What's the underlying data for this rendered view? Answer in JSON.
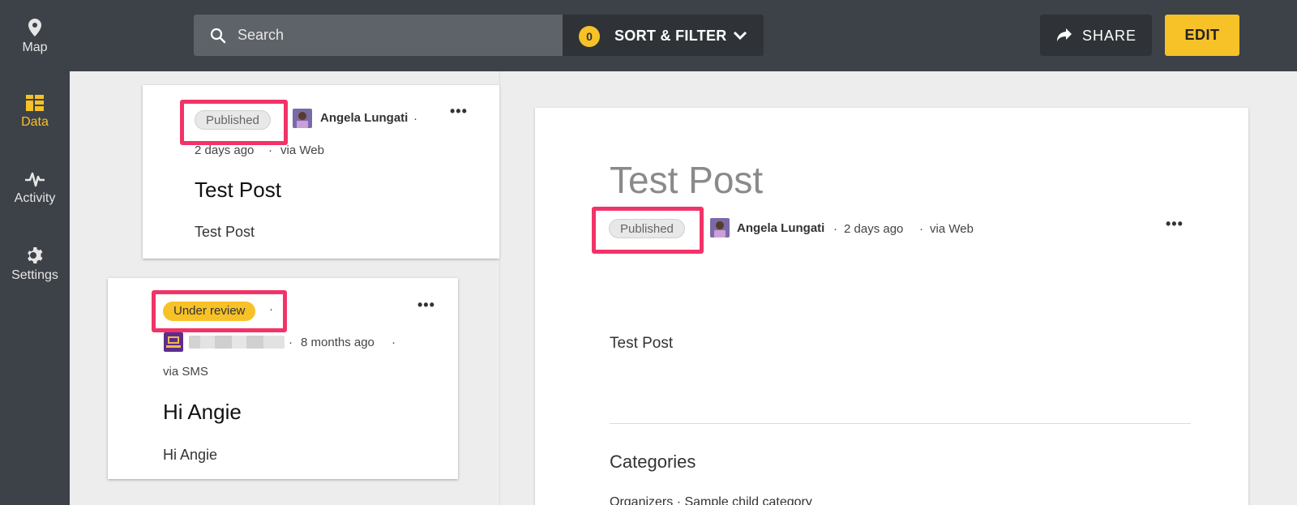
{
  "sidebar": {
    "items": [
      {
        "label": "Map",
        "icon": "map-pin-icon",
        "active": false
      },
      {
        "label": "Data",
        "icon": "data-icon",
        "active": true
      },
      {
        "label": "Activity",
        "icon": "activity-icon",
        "active": false
      },
      {
        "label": "Settings",
        "icon": "gear-icon",
        "active": false
      }
    ]
  },
  "header": {
    "search_placeholder": "Search",
    "filter_count": "0",
    "sort_filter_label": "SORT & FILTER",
    "share_label": "SHARE",
    "edit_label": "EDIT"
  },
  "posts": [
    {
      "status": "Published",
      "author": "Angela Lungati",
      "sep1": "·",
      "time": "2 days ago",
      "sep2": "·",
      "source": "via Web",
      "title": "Test Post",
      "body": "Test Post"
    },
    {
      "status": "Under review",
      "sep0": "·",
      "sep1": "·",
      "time": "8 months ago",
      "sep2": "·",
      "source": "via SMS",
      "title": "Hi Angie",
      "body": "Hi Angie"
    }
  ],
  "detail": {
    "title": "Test Post",
    "status": "Published",
    "author": "Angela Lungati",
    "sep1": "·",
    "time": "2 days ago",
    "sep2": "·",
    "source": "via Web",
    "body": "Test Post",
    "categories_heading": "Categories",
    "categories_partial": "Organizers  ·  Sample child category"
  },
  "colors": {
    "accent": "#f7c128",
    "highlight": "#f23368",
    "chrome": "#3d4248"
  }
}
